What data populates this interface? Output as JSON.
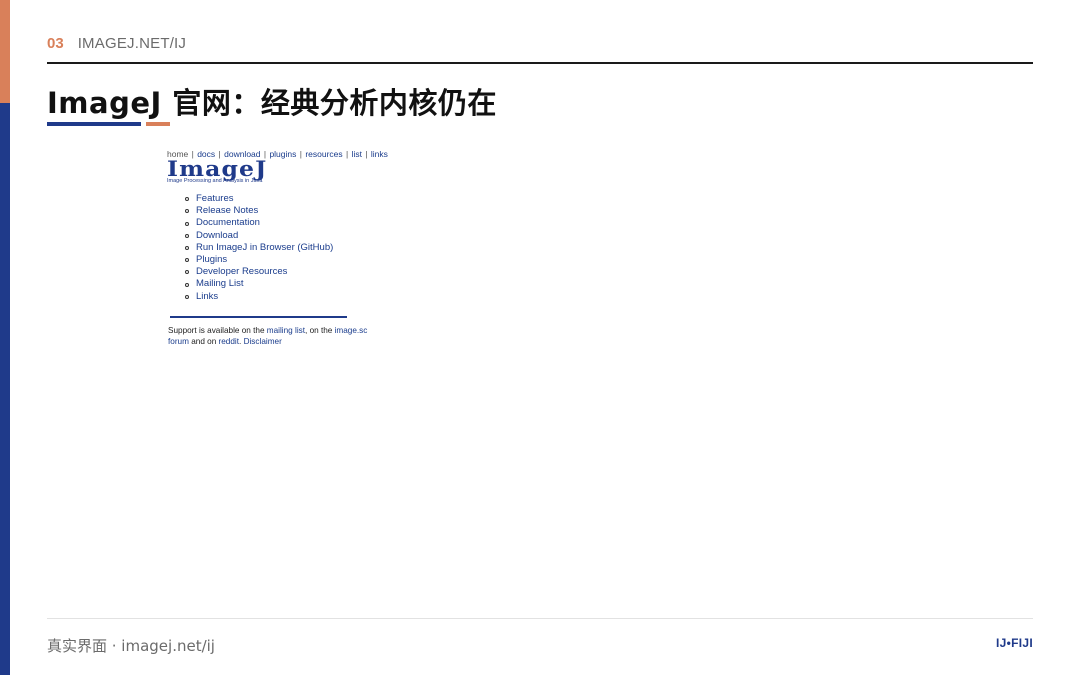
{
  "header": {
    "section_number": "03",
    "section_label": "IMAGEJ.NET/IJ"
  },
  "title": "ImageJ 官网：经典分析内核仍在",
  "colors": {
    "accent_orange": "#d9805a",
    "accent_blue": "#1f3a8a",
    "link": "#1a3c8c"
  },
  "screenshot": {
    "nav": [
      "home",
      "docs",
      "download",
      "plugins",
      "resources",
      "list",
      "links"
    ],
    "logo": "ImageJ",
    "logo_subtitle": "Image Processing and Analysis in Java",
    "links": [
      "Features",
      "Release Notes",
      "Documentation",
      "Download",
      "Run ImageJ in Browser (GitHub)",
      "Plugins",
      "Developer Resources",
      "Mailing List",
      "Links"
    ],
    "support": {
      "t1": "Support is available on the ",
      "l1": "mailing list",
      "t2": ", on the ",
      "l2": "image.sc forum",
      "t3": " and on ",
      "l3": "reddit",
      "t4": ". ",
      "l4": "Disclaimer"
    }
  },
  "footer": {
    "left": "真实界面 · imagej.net/ij",
    "right": "IJ•FIJI"
  }
}
